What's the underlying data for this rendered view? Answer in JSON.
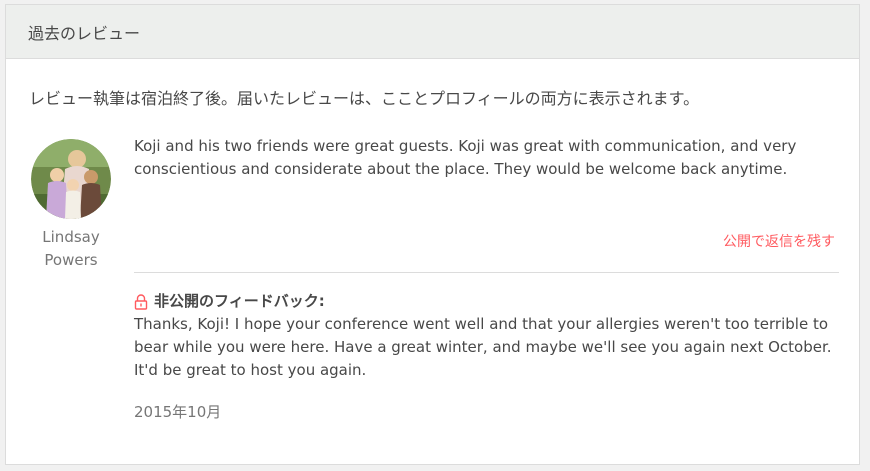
{
  "header": {
    "title": "過去のレビュー"
  },
  "intro": {
    "text": "レビュー執筆は宿泊終了後。届いたレビューは、ここと​プロフィールの両方に表示されます。"
  },
  "review": {
    "reviewer_first": "Lindsay",
    "reviewer_last": "Powers",
    "avatar_icon": "user-photo-avatar",
    "text": "Koji and his two friends were great guests. Koji was great with communication, and very conscientious and considerate about the place. They would be welcome back anytime.",
    "reply_link": "公開で返信を残す",
    "private_feedback_label": "非公開のフィードバック:",
    "private_feedback_icon": "lock-icon",
    "private_feedback_text": "Thanks, Koji! I hope your conference went well and that your allergies weren't too terrible to bear while you were here. Have a great winter, and maybe we'll see you again next October. It'd be great to host you again.",
    "date": "2015年10月"
  },
  "colors": {
    "accent": "#ff5a5f",
    "header_bg": "#edefed",
    "text": "#484848",
    "muted": "#767676"
  }
}
